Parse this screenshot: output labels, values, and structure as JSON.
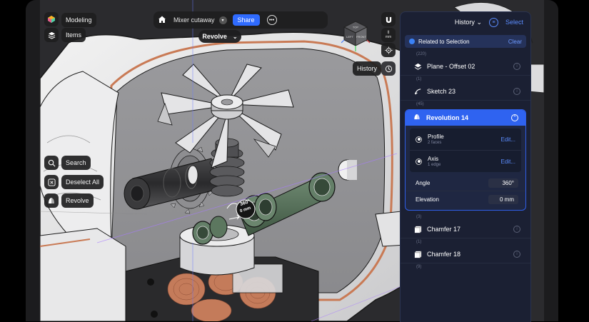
{
  "toolbar": {
    "document_title": "Mixer cutaway",
    "share_label": "Share"
  },
  "left_chips": {
    "modeling": "Modeling",
    "items": "Items",
    "search": "Search",
    "deselect_all": "Deselect All",
    "revolve": "Revolve"
  },
  "revolve_pill": "Revolve",
  "viewcube": {
    "top": "TOP",
    "left": "LEFT",
    "front": "FRONT"
  },
  "right_tools": {
    "history_label": "History",
    "unit": "mm"
  },
  "annotation": {
    "angle": "360°",
    "distance": "0 mm"
  },
  "panel": {
    "title": "History",
    "select_label": "Select",
    "related_label": "Related to Selection",
    "clear_label": "Clear",
    "items": [
      {
        "count": "(220)",
        "label": "Plane - Offset 02",
        "icon": "plane-icon"
      },
      {
        "count": "(1)",
        "label": "Sketch 23",
        "icon": "sketch-icon"
      },
      {
        "count": "(45)",
        "label": "Revolution 14",
        "icon": "revolve-icon"
      },
      {
        "count": "(3)",
        "label": "Chamfer 17",
        "icon": "chamfer-icon"
      },
      {
        "count": "(1)",
        "label": "Chamfer 18",
        "icon": "chamfer-icon"
      },
      {
        "count": "(9)"
      }
    ],
    "revolution": {
      "profile_label": "Profile",
      "profile_sub": "2 faces",
      "axis_label": "Axis",
      "axis_sub": "1 edge",
      "edit_label": "Edit...",
      "angle_label": "Angle",
      "angle_value": "360°",
      "elevation_label": "Elevation",
      "elevation_value": "0 mm"
    }
  },
  "colors": {
    "accent": "#2f63f0",
    "panel_bg": "#1b2033",
    "copper": "#c97a55",
    "green_part": "#55705a"
  }
}
